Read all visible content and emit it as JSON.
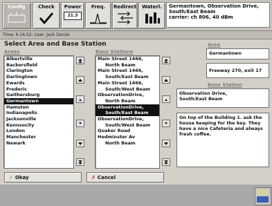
{
  "toolbar": {
    "config_label": "Config",
    "check_label": "Check",
    "power_label": "Power",
    "power_value": "21.3",
    "freq_label": "Freq.",
    "redirect_label": "Redirect",
    "waterl_label": "Waterl.",
    "info_line1": "Germantown, Observation Drive,",
    "info_line2": "South/East Beam",
    "info_line3": "carrier: ch 806, 40 dBm"
  },
  "status": "Time: 6:16:52; User: Jack Daniel",
  "heading": "Select Area and Base Station",
  "areas": {
    "label": "Areas",
    "items": [
      "Albertville",
      "Backersfield",
      "Clarington",
      "Darlingtown",
      "Ewards",
      "Frederic",
      "Gaithersburg",
      "Germantown",
      "Hamston",
      "Indianapolis",
      "Jacksonville",
      "Kennsocity",
      "London",
      "Manchester",
      "Newark"
    ],
    "selected": "Germantown"
  },
  "base_stations": {
    "label": "Base Stations",
    "items": [
      {
        "text": "Main Street 1466,",
        "sub": false
      },
      {
        "text": "North Beam",
        "sub": true
      },
      {
        "text": "Main Street 1466,",
        "sub": false
      },
      {
        "text": "South/East Beam",
        "sub": true
      },
      {
        "text": "Main Street 1466,",
        "sub": false
      },
      {
        "text": "South/West Beam",
        "sub": true
      },
      {
        "text": "ObservationDrive,",
        "sub": false
      },
      {
        "text": "North Beam",
        "sub": true
      },
      {
        "text": "ObservationDrive,",
        "sub": false,
        "selected": true
      },
      {
        "text": "South/East Beam",
        "sub": true,
        "selected": true
      },
      {
        "text": "ObservationDrive,",
        "sub": false
      },
      {
        "text": "South/West Beam",
        "sub": true
      },
      {
        "text": "Quaker Road",
        "sub": false
      },
      {
        "text": "Hedminster Av",
        "sub": false
      },
      {
        "text": "North Beam",
        "sub": true
      }
    ]
  },
  "area_panel": {
    "label": "Area",
    "value": "Germantown",
    "detail": "Freeway 270, exit 17"
  },
  "base_station_panel": {
    "label": "Base Station",
    "value": "Observation Drive,\nSouth/East Beam",
    "notes": "On top of the Building 1. ask the house keeping for the key. They have a nice Cafeteria and always fresh coffee."
  },
  "buttons": {
    "okay": "Okay",
    "cancel": "Cancel"
  }
}
